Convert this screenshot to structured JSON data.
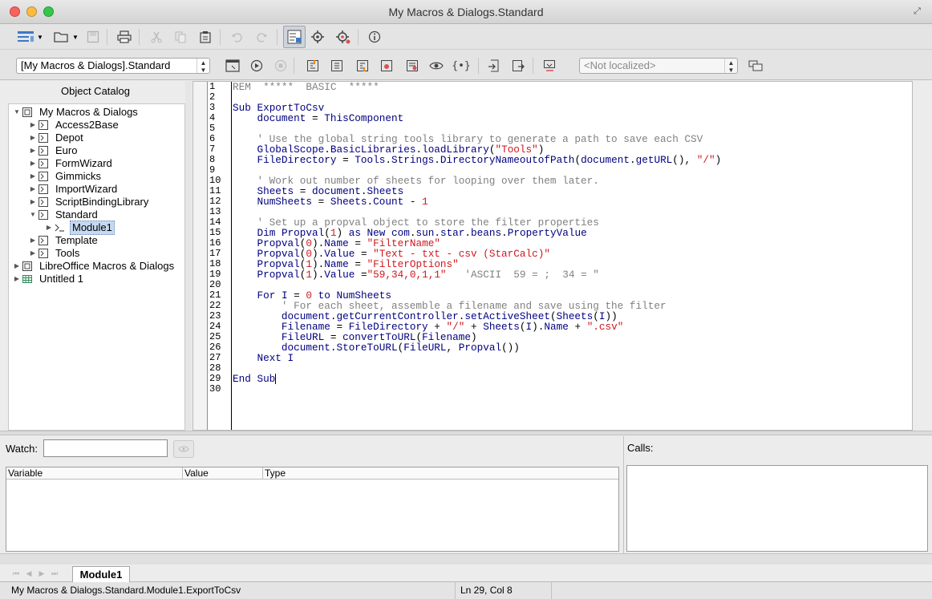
{
  "window": {
    "title": "My Macros & Dialogs.Standard"
  },
  "toolbar2": {
    "library_select": "[My Macros & Dialogs].Standard",
    "language_select": "<Not localized>"
  },
  "catalog": {
    "title": "Object Catalog",
    "tree": [
      {
        "label": "My Macros & Dialogs",
        "level": 0,
        "expanded": true,
        "icon": "macros-container-icon"
      },
      {
        "label": "Access2Base",
        "level": 1,
        "expanded": false,
        "icon": "library-icon"
      },
      {
        "label": "Depot",
        "level": 1,
        "expanded": false,
        "icon": "library-icon"
      },
      {
        "label": "Euro",
        "level": 1,
        "expanded": false,
        "icon": "library-icon"
      },
      {
        "label": "FormWizard",
        "level": 1,
        "expanded": false,
        "icon": "library-icon"
      },
      {
        "label": "Gimmicks",
        "level": 1,
        "expanded": false,
        "icon": "library-icon"
      },
      {
        "label": "ImportWizard",
        "level": 1,
        "expanded": false,
        "icon": "library-icon"
      },
      {
        "label": "ScriptBindingLibrary",
        "level": 1,
        "expanded": false,
        "icon": "library-icon"
      },
      {
        "label": "Standard",
        "level": 1,
        "expanded": true,
        "icon": "library-icon"
      },
      {
        "label": "Module1",
        "level": 2,
        "expanded": false,
        "icon": "module-icon",
        "selected": true
      },
      {
        "label": "Template",
        "level": 1,
        "expanded": false,
        "icon": "library-icon"
      },
      {
        "label": "Tools",
        "level": 1,
        "expanded": false,
        "icon": "library-icon"
      },
      {
        "label": "LibreOffice Macros & Dialogs",
        "level": 0,
        "expanded": false,
        "icon": "macros-container-icon"
      },
      {
        "label": "Untitled 1",
        "level": 0,
        "expanded": false,
        "icon": "spreadsheet-icon"
      }
    ]
  },
  "editor": {
    "lines": [
      [
        [
          "c",
          "REM  *****  BASIC  *****"
        ]
      ],
      [],
      [
        [
          "k",
          "Sub "
        ],
        [
          "k",
          "ExportToCsv"
        ]
      ],
      [
        [
          "t",
          "    "
        ],
        [
          "k",
          "document"
        ],
        [
          "t",
          " = "
        ],
        [
          "k",
          "ThisComponent"
        ]
      ],
      [],
      [
        [
          "c",
          "    ' Use the global string tools library to generate a path to save each CSV"
        ]
      ],
      [
        [
          "t",
          "    "
        ],
        [
          "k",
          "GlobalScope"
        ],
        [
          "t",
          "."
        ],
        [
          "k",
          "BasicLibraries"
        ],
        [
          "t",
          "."
        ],
        [
          "k",
          "loadLibrary"
        ],
        [
          "t",
          "("
        ],
        [
          "s",
          "\"Tools\""
        ],
        [
          "t",
          ")"
        ]
      ],
      [
        [
          "t",
          "    "
        ],
        [
          "k",
          "FileDirectory"
        ],
        [
          "t",
          " = "
        ],
        [
          "k",
          "Tools"
        ],
        [
          "t",
          "."
        ],
        [
          "k",
          "Strings"
        ],
        [
          "t",
          "."
        ],
        [
          "k",
          "DirectoryNameoutofPath"
        ],
        [
          "t",
          "("
        ],
        [
          "k",
          "document"
        ],
        [
          "t",
          "."
        ],
        [
          "k",
          "getURL"
        ],
        [
          "t",
          "(), "
        ],
        [
          "s",
          "\"/\""
        ],
        [
          "t",
          ")"
        ]
      ],
      [],
      [
        [
          "c",
          "    ' Work out number of sheets for looping over them later."
        ]
      ],
      [
        [
          "t",
          "    "
        ],
        [
          "k",
          "Sheets"
        ],
        [
          "t",
          " = "
        ],
        [
          "k",
          "document"
        ],
        [
          "t",
          "."
        ],
        [
          "k",
          "Sheets"
        ]
      ],
      [
        [
          "t",
          "    "
        ],
        [
          "k",
          "NumSheets"
        ],
        [
          "t",
          " = "
        ],
        [
          "k",
          "Sheets"
        ],
        [
          "t",
          "."
        ],
        [
          "k",
          "Count"
        ],
        [
          "t",
          " - "
        ],
        [
          "n",
          "1"
        ]
      ],
      [],
      [
        [
          "c",
          "    ' Set up a propval object to store the filter properties"
        ]
      ],
      [
        [
          "t",
          "    "
        ],
        [
          "k",
          "Dim "
        ],
        [
          "k",
          "Propval"
        ],
        [
          "t",
          "("
        ],
        [
          "n",
          "1"
        ],
        [
          "t",
          ") "
        ],
        [
          "k",
          "as New "
        ],
        [
          "k",
          "com"
        ],
        [
          "t",
          "."
        ],
        [
          "k",
          "sun"
        ],
        [
          "t",
          "."
        ],
        [
          "k",
          "star"
        ],
        [
          "t",
          "."
        ],
        [
          "k",
          "beans"
        ],
        [
          "t",
          "."
        ],
        [
          "k",
          "PropertyValue"
        ]
      ],
      [
        [
          "t",
          "    "
        ],
        [
          "k",
          "Propval"
        ],
        [
          "t",
          "("
        ],
        [
          "n",
          "0"
        ],
        [
          "t",
          ")."
        ],
        [
          "k",
          "Name"
        ],
        [
          "t",
          " = "
        ],
        [
          "s",
          "\"FilterName\""
        ]
      ],
      [
        [
          "t",
          "    "
        ],
        [
          "k",
          "Propval"
        ],
        [
          "t",
          "("
        ],
        [
          "n",
          "0"
        ],
        [
          "t",
          ")."
        ],
        [
          "k",
          "Value"
        ],
        [
          "t",
          " = "
        ],
        [
          "s",
          "\"Text - txt - csv (StarCalc)\""
        ]
      ],
      [
        [
          "t",
          "    "
        ],
        [
          "k",
          "Propval"
        ],
        [
          "t",
          "("
        ],
        [
          "n",
          "1"
        ],
        [
          "t",
          ")."
        ],
        [
          "k",
          "Name"
        ],
        [
          "t",
          " = "
        ],
        [
          "s",
          "\"FilterOptions\""
        ]
      ],
      [
        [
          "t",
          "    "
        ],
        [
          "k",
          "Propval"
        ],
        [
          "t",
          "("
        ],
        [
          "n",
          "1"
        ],
        [
          "t",
          ")."
        ],
        [
          "k",
          "Value"
        ],
        [
          "t",
          " ="
        ],
        [
          "s",
          "\"59,34,0,1,1\""
        ],
        [
          "c",
          "   'ASCII  59 = ;  34 = \""
        ]
      ],
      [],
      [
        [
          "t",
          "    "
        ],
        [
          "k",
          "For "
        ],
        [
          "k",
          "I"
        ],
        [
          "t",
          " = "
        ],
        [
          "n",
          "0"
        ],
        [
          "k",
          " to "
        ],
        [
          "k",
          "NumSheets"
        ]
      ],
      [
        [
          "c",
          "        ' For each sheet, assemble a filename and save using the filter"
        ]
      ],
      [
        [
          "t",
          "        "
        ],
        [
          "k",
          "document"
        ],
        [
          "t",
          "."
        ],
        [
          "k",
          "getCurrentController"
        ],
        [
          "t",
          "."
        ],
        [
          "k",
          "setActiveSheet"
        ],
        [
          "t",
          "("
        ],
        [
          "k",
          "Sheets"
        ],
        [
          "t",
          "("
        ],
        [
          "k",
          "I"
        ],
        [
          "t",
          "))"
        ]
      ],
      [
        [
          "t",
          "        "
        ],
        [
          "k",
          "Filename"
        ],
        [
          "t",
          " = "
        ],
        [
          "k",
          "FileDirectory"
        ],
        [
          "t",
          " + "
        ],
        [
          "s",
          "\"/\""
        ],
        [
          "t",
          " + "
        ],
        [
          "k",
          "Sheets"
        ],
        [
          "t",
          "("
        ],
        [
          "k",
          "I"
        ],
        [
          "t",
          ")."
        ],
        [
          "k",
          "Name"
        ],
        [
          "t",
          " + "
        ],
        [
          "s",
          "\".csv\""
        ]
      ],
      [
        [
          "t",
          "        "
        ],
        [
          "k",
          "FileURL"
        ],
        [
          "t",
          " = "
        ],
        [
          "k",
          "convertToURL"
        ],
        [
          "t",
          "("
        ],
        [
          "k",
          "Filename"
        ],
        [
          "t",
          ")"
        ]
      ],
      [
        [
          "t",
          "        "
        ],
        [
          "k",
          "document"
        ],
        [
          "t",
          "."
        ],
        [
          "k",
          "StoreToURL"
        ],
        [
          "t",
          "("
        ],
        [
          "k",
          "FileURL"
        ],
        [
          "t",
          ", "
        ],
        [
          "k",
          "Propval"
        ],
        [
          "t",
          "())"
        ]
      ],
      [
        [
          "t",
          "    "
        ],
        [
          "k",
          "Next "
        ],
        [
          "k",
          "I"
        ]
      ],
      [],
      [
        [
          "k",
          "End Sub"
        ]
      ],
      []
    ],
    "line_numbers": [
      "1",
      "2",
      "3",
      "4",
      "5",
      "6",
      "7",
      "8",
      "9",
      "10",
      "11",
      "12",
      "13",
      "14",
      "15",
      "16",
      "17",
      "18",
      "19",
      "20",
      "21",
      "22",
      "23",
      "24",
      "25",
      "26",
      "27",
      "28",
      "29",
      "30"
    ]
  },
  "watch": {
    "label": "Watch:",
    "value": "",
    "columns": [
      "Variable",
      "Value",
      "Type"
    ]
  },
  "calls": {
    "label": "Calls:"
  },
  "tabs": [
    {
      "label": "Module1",
      "active": true
    }
  ],
  "status": {
    "location": "My Macros & Dialogs.Standard.Module1.ExportToCsv",
    "position": "Ln 29, Col 8"
  },
  "colors": {
    "keyword": "#000080",
    "comment": "#808080",
    "string": "#ce181e",
    "number": "#ce181e",
    "selection": "#c5d9f1"
  }
}
